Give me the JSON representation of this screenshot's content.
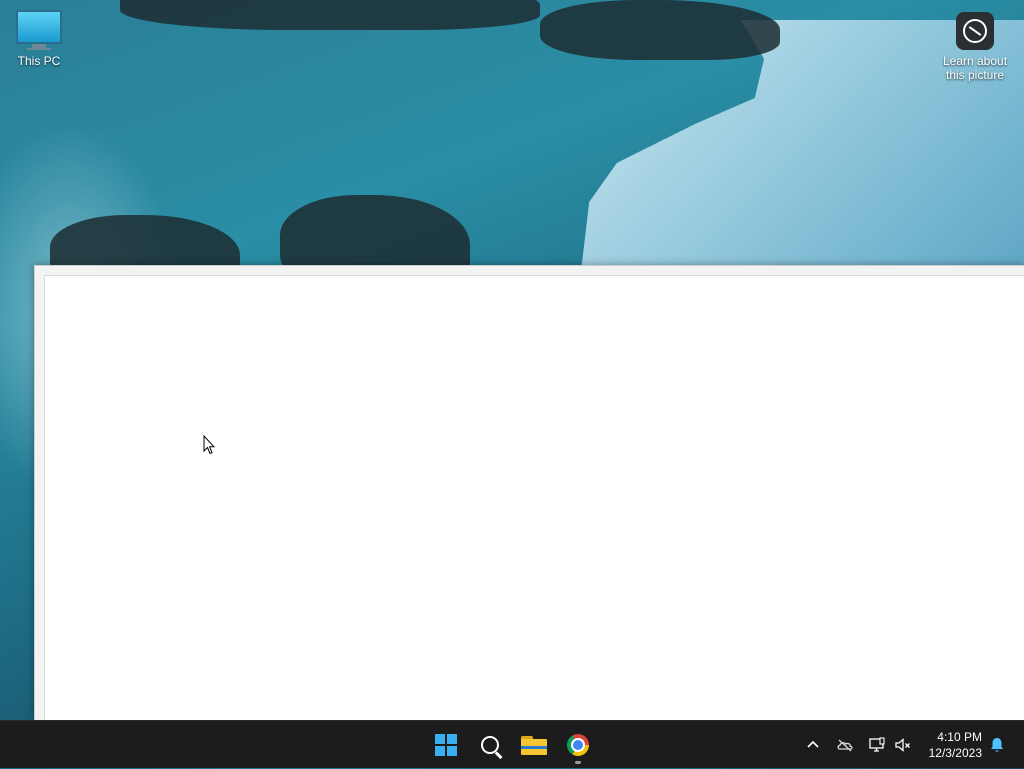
{
  "desktop": {
    "icons": [
      {
        "label": "This PC"
      },
      {
        "label": "Learn about this picture",
        "label_line1": "Learn about",
        "label_line2": "this picture"
      }
    ]
  },
  "window": {
    "content": ""
  },
  "taskbar": {
    "apps": [
      {
        "name": "start",
        "icon": "windows-logo-icon"
      },
      {
        "name": "search",
        "icon": "search-icon"
      },
      {
        "name": "file-explorer",
        "icon": "folder-icon"
      },
      {
        "name": "chrome",
        "icon": "chrome-icon",
        "running": true
      }
    ],
    "tray": {
      "icons": [
        "chevron-up-icon",
        "onedrive-cloud-icon",
        "network-icon",
        "volume-muted-icon",
        "notification-bell-icon"
      ],
      "time": "4:10 PM",
      "date": "12/3/2023"
    }
  },
  "colors": {
    "taskbar_bg": "#1c1c1c",
    "accent": "#3bb0f0",
    "window_bg": "#ffffff"
  }
}
